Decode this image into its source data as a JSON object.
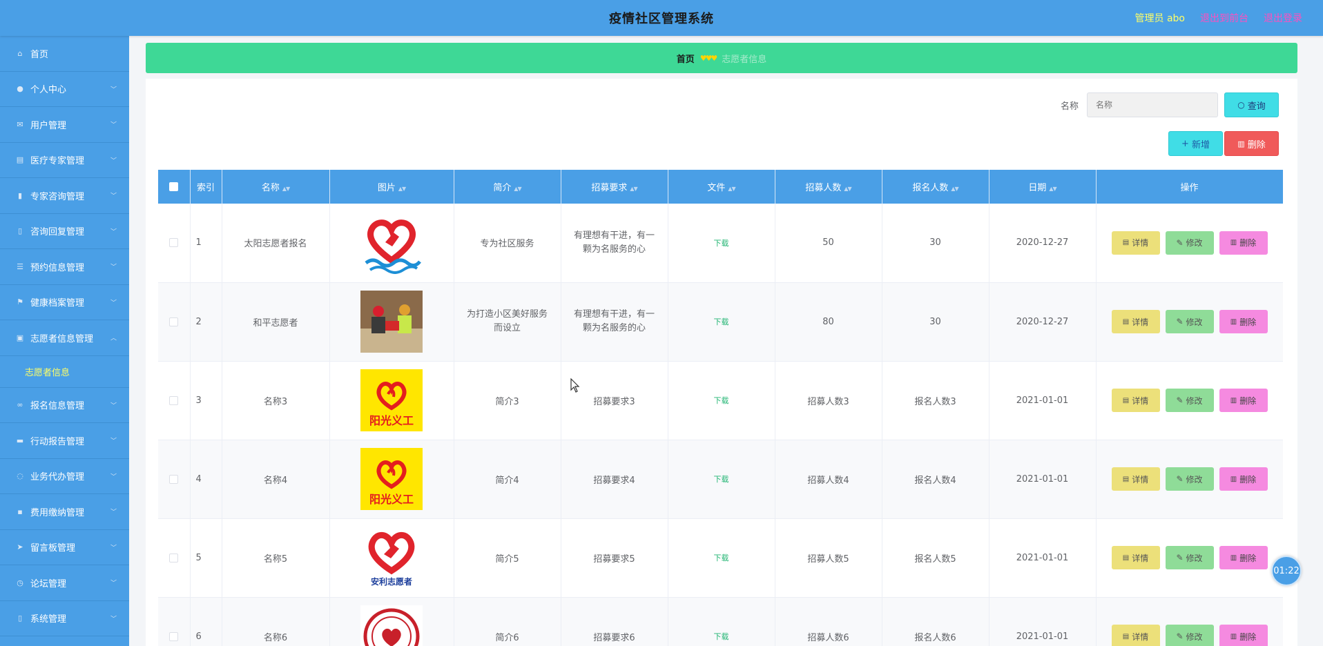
{
  "header": {
    "title": "疫情社区管理系统",
    "admin_label": "管理员 abo",
    "back_frontend": "退出到前台",
    "logout": "退出登录"
  },
  "sidebar": {
    "items": [
      {
        "label": "首页",
        "icon": "home-icon",
        "chevron": false
      },
      {
        "label": "个人中心",
        "icon": "user-icon",
        "chevron": true
      },
      {
        "label": "用户管理",
        "icon": "mail-icon",
        "chevron": true
      },
      {
        "label": "医疗专家管理",
        "icon": "document-icon",
        "chevron": true
      },
      {
        "label": "专家咨询管理",
        "icon": "chart-icon",
        "chevron": true
      },
      {
        "label": "咨询回复管理",
        "icon": "mic-icon",
        "chevron": true
      },
      {
        "label": "预约信息管理",
        "icon": "list-icon",
        "chevron": true
      },
      {
        "label": "健康档案管理",
        "icon": "flag-icon",
        "chevron": true
      },
      {
        "label": "志愿者信息管理",
        "icon": "clipboard-icon",
        "chevron": true,
        "expanded": true
      }
    ],
    "subitem": {
      "label": "志愿者信息"
    },
    "items2": [
      {
        "label": "报名信息管理",
        "icon": "link-icon"
      },
      {
        "label": "行动报告管理",
        "icon": "printer-icon"
      },
      {
        "label": "业务代办管理",
        "icon": "power-icon"
      },
      {
        "label": "费用缴纳管理",
        "icon": "wallet-icon"
      },
      {
        "label": "留言板管理",
        "icon": "send-icon"
      },
      {
        "label": "论坛管理",
        "icon": "clock-icon"
      },
      {
        "label": "系统管理",
        "icon": "mic-icon"
      }
    ]
  },
  "breadcrumb": {
    "home": "首页",
    "current": "志愿者信息"
  },
  "search": {
    "label": "名称",
    "placeholder": "名称",
    "query_button": "查询"
  },
  "toolbar": {
    "add_button": "新增",
    "delete_button": "删除"
  },
  "table": {
    "headers": [
      "索引",
      "名称",
      "图片",
      "简介",
      "招募要求",
      "文件",
      "招募人数",
      "报名人数",
      "日期",
      "操作"
    ],
    "rows": [
      {
        "idx": "1",
        "name": "太阳志愿者报名",
        "image": "heart-logo-blue",
        "intro": "专为社区服务",
        "req": "有理想有干进，有一颗为名服务的心",
        "file": "下载",
        "recruit": "50",
        "enrolled": "30",
        "date": "2020-12-27"
      },
      {
        "idx": "2",
        "name": "和平志愿者",
        "image": "volunteer-photo",
        "intro": "为打造小区美好服务而设立",
        "req": "有理想有干进，有一颗为名服务的心",
        "file": "下载",
        "recruit": "80",
        "enrolled": "30",
        "date": "2020-12-27"
      },
      {
        "idx": "3",
        "name": "名称3",
        "image": "sunshine-logo",
        "intro": "简介3",
        "req": "招募要求3",
        "file": "下载",
        "recruit": "招募人数3",
        "enrolled": "报名人数3",
        "date": "2021-01-01"
      },
      {
        "idx": "4",
        "name": "名称4",
        "image": "sunshine-logo",
        "intro": "简介4",
        "req": "招募要求4",
        "file": "下载",
        "recruit": "招募人数4",
        "enrolled": "报名人数4",
        "date": "2021-01-01"
      },
      {
        "idx": "5",
        "name": "名称5",
        "image": "anli-logo",
        "intro": "简介5",
        "req": "招募要求5",
        "file": "下载",
        "recruit": "招募人数5",
        "enrolled": "报名人数5",
        "date": "2021-01-01"
      },
      {
        "idx": "6",
        "name": "名称6",
        "image": "seal-logo",
        "intro": "简介6",
        "req": "招募要求6",
        "file": "下载",
        "recruit": "招募人数6",
        "enrolled": "报名人数6",
        "date": "2021-01-01"
      }
    ],
    "ops": {
      "detail": "详情",
      "edit": "修改",
      "delete": "删除"
    }
  },
  "logo_text": {
    "sunshine": "阳光义工",
    "anli": "安利志愿者"
  },
  "timer": "01:22",
  "colors": {
    "header_bg": "#4a9fe6",
    "breadcrumb_bg": "#3ed896",
    "admin_text": "#ffff66",
    "link_text": "#ff4fbf"
  }
}
